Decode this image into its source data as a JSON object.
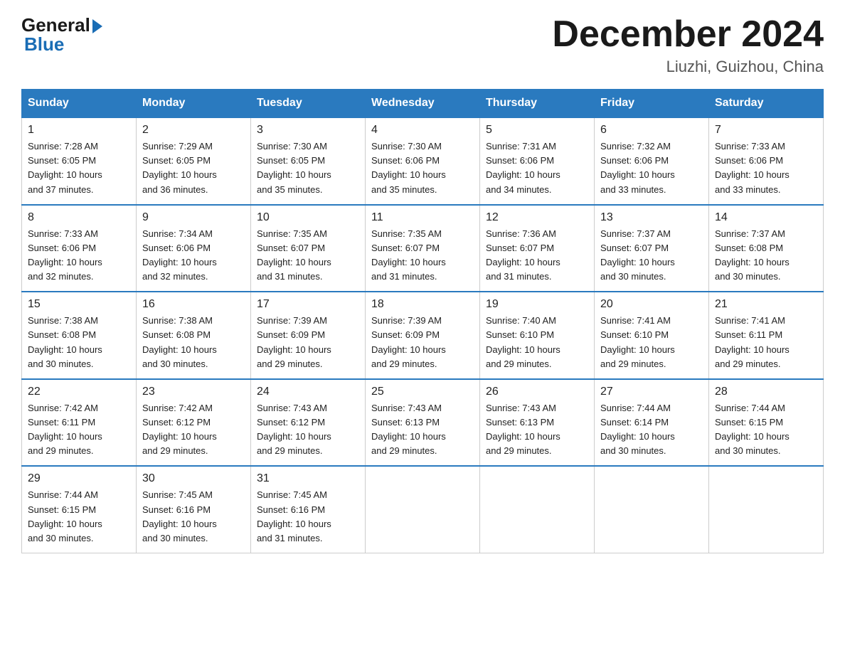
{
  "logo": {
    "general": "General",
    "blue": "Blue"
  },
  "title": "December 2024",
  "location": "Liuzhi, Guizhou, China",
  "days_of_week": [
    "Sunday",
    "Monday",
    "Tuesday",
    "Wednesday",
    "Thursday",
    "Friday",
    "Saturday"
  ],
  "weeks": [
    [
      {
        "day": "1",
        "sunrise": "7:28 AM",
        "sunset": "6:05 PM",
        "daylight": "10 hours and 37 minutes."
      },
      {
        "day": "2",
        "sunrise": "7:29 AM",
        "sunset": "6:05 PM",
        "daylight": "10 hours and 36 minutes."
      },
      {
        "day": "3",
        "sunrise": "7:30 AM",
        "sunset": "6:05 PM",
        "daylight": "10 hours and 35 minutes."
      },
      {
        "day": "4",
        "sunrise": "7:30 AM",
        "sunset": "6:06 PM",
        "daylight": "10 hours and 35 minutes."
      },
      {
        "day": "5",
        "sunrise": "7:31 AM",
        "sunset": "6:06 PM",
        "daylight": "10 hours and 34 minutes."
      },
      {
        "day": "6",
        "sunrise": "7:32 AM",
        "sunset": "6:06 PM",
        "daylight": "10 hours and 33 minutes."
      },
      {
        "day": "7",
        "sunrise": "7:33 AM",
        "sunset": "6:06 PM",
        "daylight": "10 hours and 33 minutes."
      }
    ],
    [
      {
        "day": "8",
        "sunrise": "7:33 AM",
        "sunset": "6:06 PM",
        "daylight": "10 hours and 32 minutes."
      },
      {
        "day": "9",
        "sunrise": "7:34 AM",
        "sunset": "6:06 PM",
        "daylight": "10 hours and 32 minutes."
      },
      {
        "day": "10",
        "sunrise": "7:35 AM",
        "sunset": "6:07 PM",
        "daylight": "10 hours and 31 minutes."
      },
      {
        "day": "11",
        "sunrise": "7:35 AM",
        "sunset": "6:07 PM",
        "daylight": "10 hours and 31 minutes."
      },
      {
        "day": "12",
        "sunrise": "7:36 AM",
        "sunset": "6:07 PM",
        "daylight": "10 hours and 31 minutes."
      },
      {
        "day": "13",
        "sunrise": "7:37 AM",
        "sunset": "6:07 PM",
        "daylight": "10 hours and 30 minutes."
      },
      {
        "day": "14",
        "sunrise": "7:37 AM",
        "sunset": "6:08 PM",
        "daylight": "10 hours and 30 minutes."
      }
    ],
    [
      {
        "day": "15",
        "sunrise": "7:38 AM",
        "sunset": "6:08 PM",
        "daylight": "10 hours and 30 minutes."
      },
      {
        "day": "16",
        "sunrise": "7:38 AM",
        "sunset": "6:08 PM",
        "daylight": "10 hours and 30 minutes."
      },
      {
        "day": "17",
        "sunrise": "7:39 AM",
        "sunset": "6:09 PM",
        "daylight": "10 hours and 29 minutes."
      },
      {
        "day": "18",
        "sunrise": "7:39 AM",
        "sunset": "6:09 PM",
        "daylight": "10 hours and 29 minutes."
      },
      {
        "day": "19",
        "sunrise": "7:40 AM",
        "sunset": "6:10 PM",
        "daylight": "10 hours and 29 minutes."
      },
      {
        "day": "20",
        "sunrise": "7:41 AM",
        "sunset": "6:10 PM",
        "daylight": "10 hours and 29 minutes."
      },
      {
        "day": "21",
        "sunrise": "7:41 AM",
        "sunset": "6:11 PM",
        "daylight": "10 hours and 29 minutes."
      }
    ],
    [
      {
        "day": "22",
        "sunrise": "7:42 AM",
        "sunset": "6:11 PM",
        "daylight": "10 hours and 29 minutes."
      },
      {
        "day": "23",
        "sunrise": "7:42 AM",
        "sunset": "6:12 PM",
        "daylight": "10 hours and 29 minutes."
      },
      {
        "day": "24",
        "sunrise": "7:43 AM",
        "sunset": "6:12 PM",
        "daylight": "10 hours and 29 minutes."
      },
      {
        "day": "25",
        "sunrise": "7:43 AM",
        "sunset": "6:13 PM",
        "daylight": "10 hours and 29 minutes."
      },
      {
        "day": "26",
        "sunrise": "7:43 AM",
        "sunset": "6:13 PM",
        "daylight": "10 hours and 29 minutes."
      },
      {
        "day": "27",
        "sunrise": "7:44 AM",
        "sunset": "6:14 PM",
        "daylight": "10 hours and 30 minutes."
      },
      {
        "day": "28",
        "sunrise": "7:44 AM",
        "sunset": "6:15 PM",
        "daylight": "10 hours and 30 minutes."
      }
    ],
    [
      {
        "day": "29",
        "sunrise": "7:44 AM",
        "sunset": "6:15 PM",
        "daylight": "10 hours and 30 minutes."
      },
      {
        "day": "30",
        "sunrise": "7:45 AM",
        "sunset": "6:16 PM",
        "daylight": "10 hours and 30 minutes."
      },
      {
        "day": "31",
        "sunrise": "7:45 AM",
        "sunset": "6:16 PM",
        "daylight": "10 hours and 31 minutes."
      },
      null,
      null,
      null,
      null
    ]
  ],
  "labels": {
    "sunrise": "Sunrise:",
    "sunset": "Sunset:",
    "daylight": "Daylight:"
  }
}
